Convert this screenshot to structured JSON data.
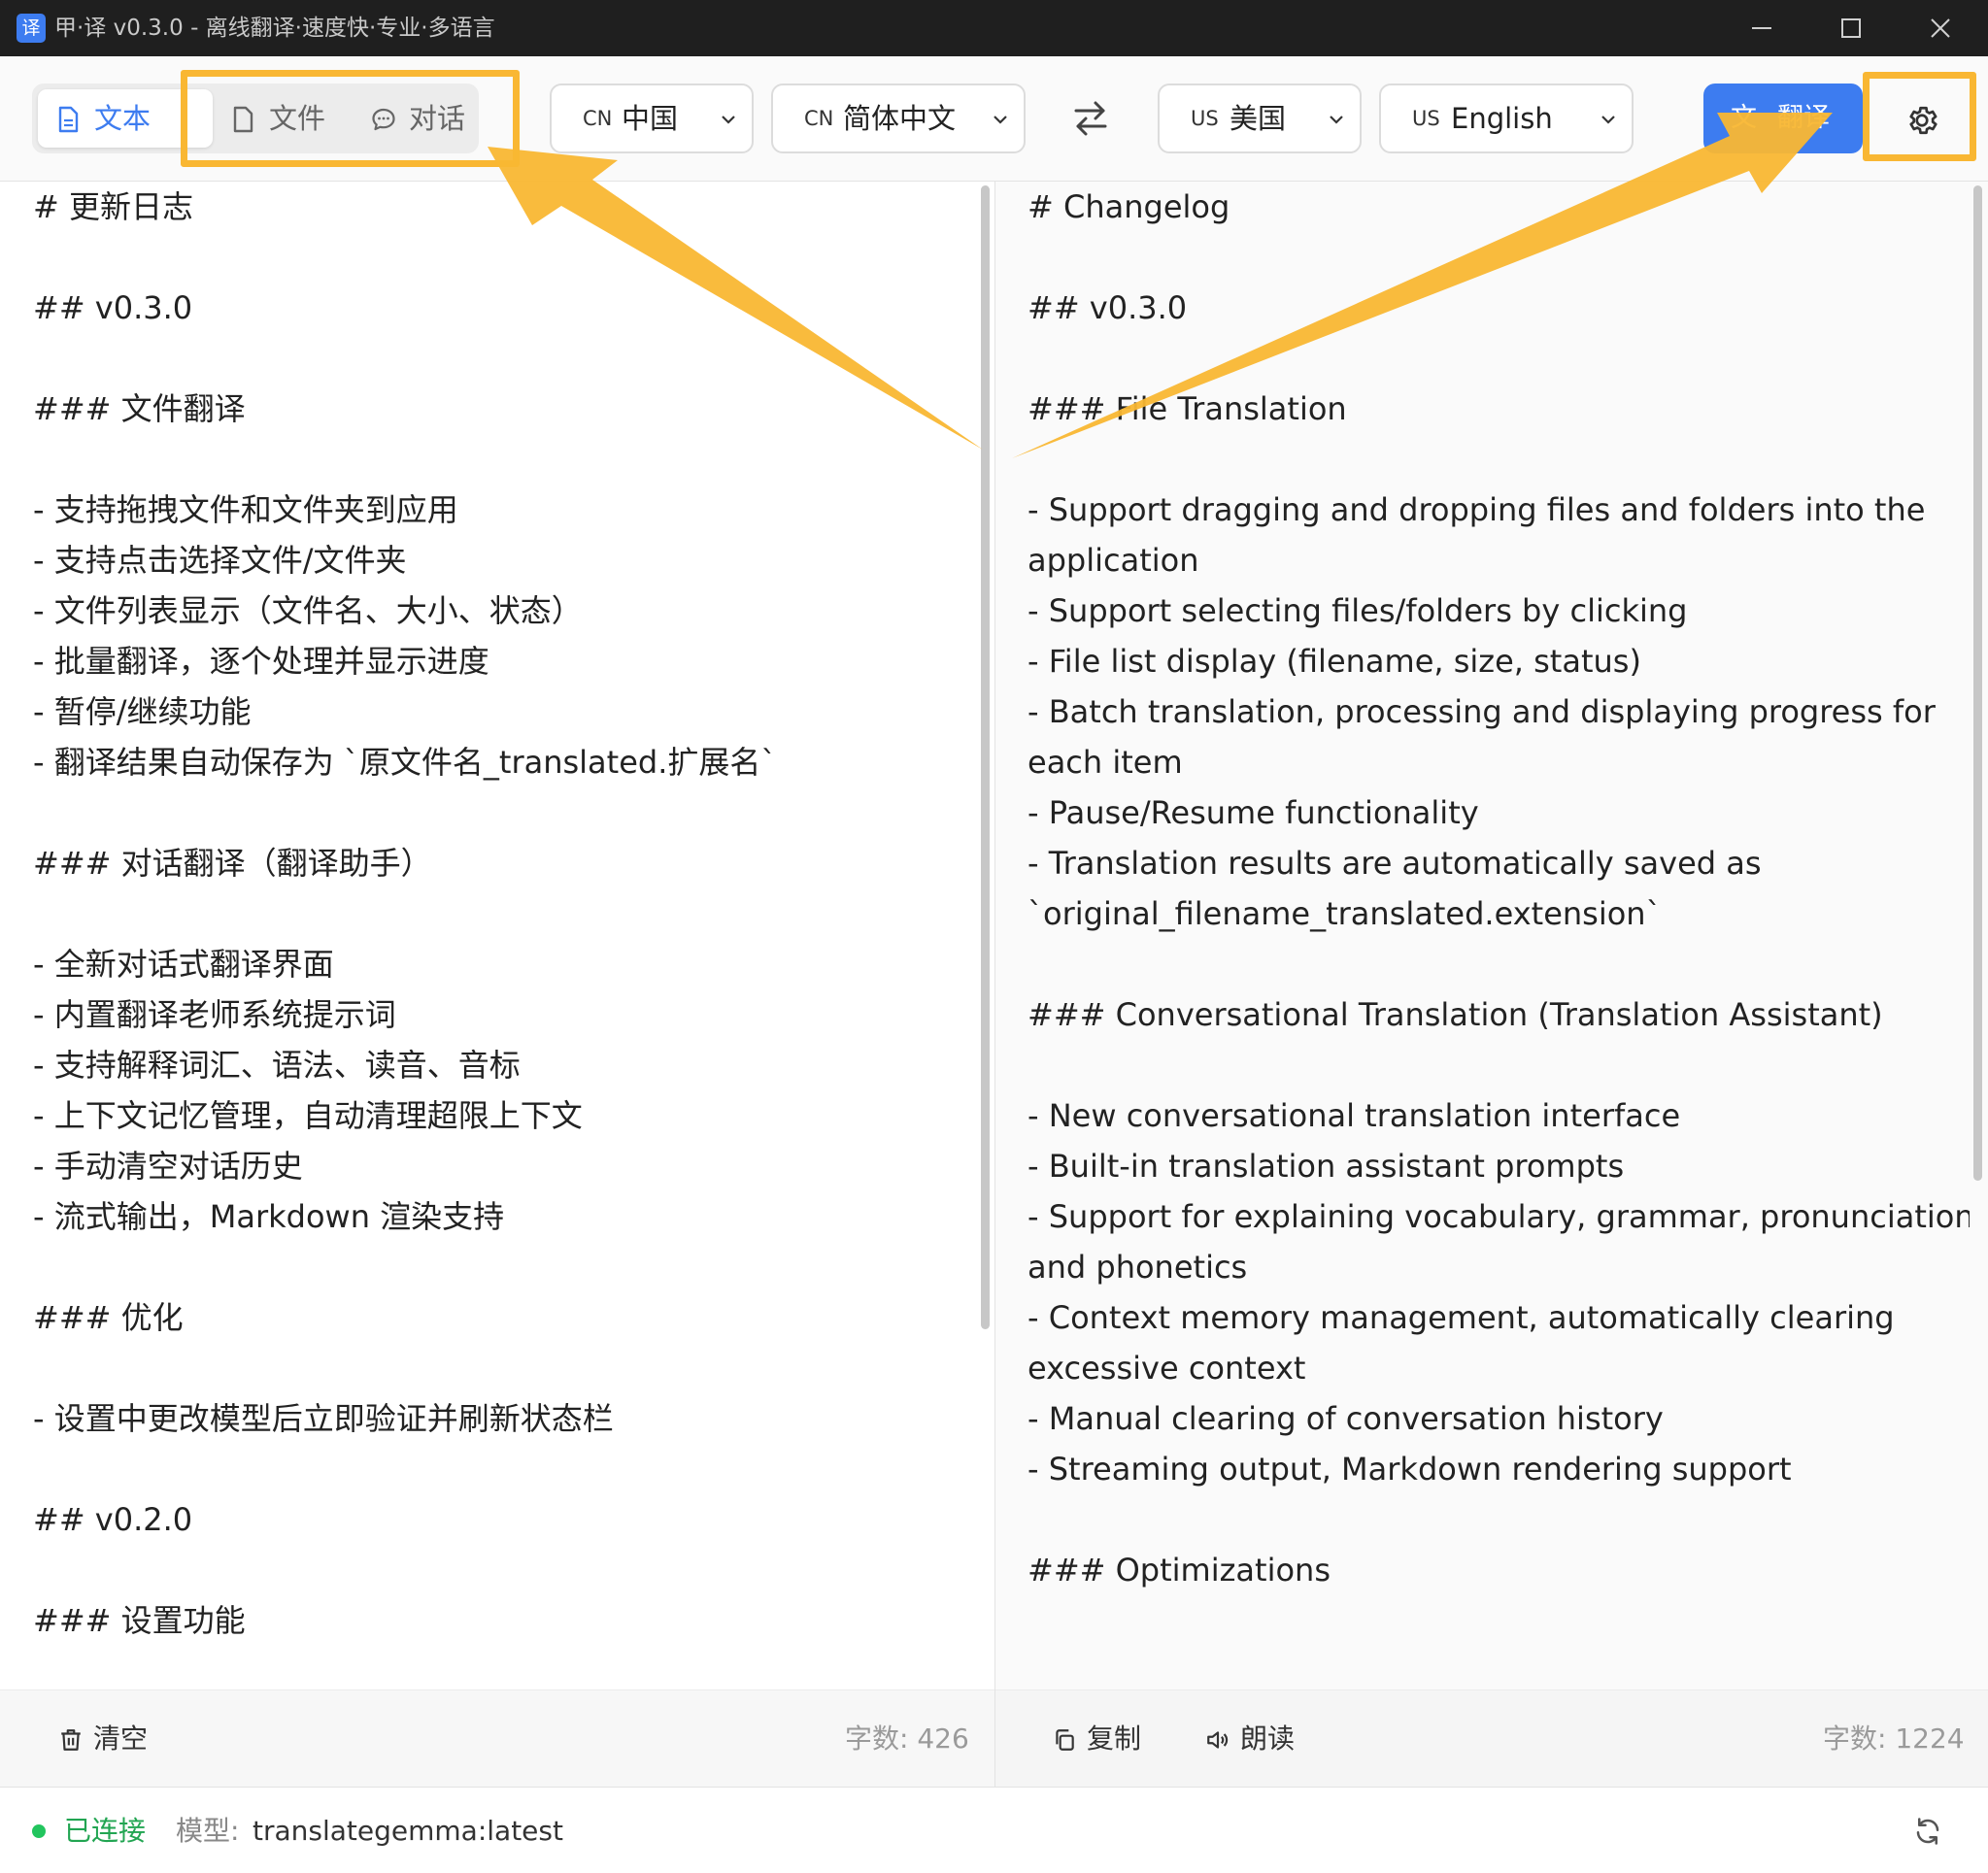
{
  "window": {
    "app_icon_glyph": "译",
    "title": "甲·译 v0.3.0 - 离线翻译·速度快·专业·多语言"
  },
  "toolbar": {
    "tabs": [
      {
        "label": "文本",
        "icon": "document-icon",
        "active": true
      },
      {
        "label": "文件",
        "icon": "file-icon",
        "active": false
      },
      {
        "label": "对话",
        "icon": "chat-bubble-icon",
        "active": false
      }
    ],
    "source_country": {
      "flag": "CN",
      "label": "中国"
    },
    "source_language": {
      "flag": "CN",
      "label": "简体中文"
    },
    "target_country": {
      "flag": "US",
      "label": "美国"
    },
    "target_language": {
      "flag": "US",
      "label": "English"
    },
    "swap_icon": "swap-arrows-icon",
    "translate_button": {
      "icon_glyph": "文",
      "label": "翻译"
    },
    "settings_icon": "gear-icon",
    "accent_color": "#3d7cf0"
  },
  "source": {
    "lines": [
      "# 更新日志",
      "",
      "## v0.3.0",
      "",
      "### 文件翻译",
      "",
      "- 支持拖拽文件和文件夹到应用",
      "- 支持点击选择文件/文件夹",
      "- 文件列表显示（文件名、大小、状态）",
      "- 批量翻译，逐个处理并显示进度",
      "- 暂停/继续功能",
      "- 翻译结果自动保存为 `原文件名_translated.扩展名`",
      "",
      "### 对话翻译（翻译助手）",
      "",
      "- 全新对话式翻译界面",
      "- 内置翻译老师系统提示词",
      "- 支持解释词汇、语法、读音、音标",
      "- 上下文记忆管理，自动清理超限上下文",
      "- 手动清空对话历史",
      "- 流式输出，Markdown 渲染支持",
      "",
      "### 优化",
      "",
      "- 设置中更改模型后立即验证并刷新状态栏",
      "",
      "## v0.2.0",
      "",
      "### 设置功能"
    ],
    "clear_label": "清空",
    "count_text": "字数: 426"
  },
  "target": {
    "lines": [
      "# Changelog",
      "",
      "## v0.3.0",
      "",
      "### File Translation",
      "",
      "- Support dragging and dropping files and folders into the",
      "application",
      "- Support selecting files/folders by clicking",
      "- File list display (filename, size, status)",
      "- Batch translation, processing and displaying progress for",
      "each item",
      "- Pause/Resume functionality",
      "- Translation results are automatically saved as",
      "`original_filename_translated.extension`",
      "",
      "### Conversational Translation (Translation Assistant)",
      "",
      "- New conversational translation interface",
      "- Built-in translation assistant prompts",
      "- Support for explaining vocabulary, grammar, pronunciation,",
      "and phonetics",
      "- Context memory management, automatically clearing",
      "excessive context",
      "- Manual clearing of conversation history",
      "- Streaming output, Markdown rendering support",
      "",
      "### Optimizations"
    ],
    "copy_label": "复制",
    "read_label": "朗读",
    "count_text": "字数: 1224"
  },
  "statusbar": {
    "status": "已连接",
    "status_color": "#22c55e",
    "model_label": "模型:",
    "model_value": "translategemma:latest",
    "refresh_icon": "refresh-icon"
  },
  "annotation": {
    "highlight_color": "#f9b733"
  }
}
